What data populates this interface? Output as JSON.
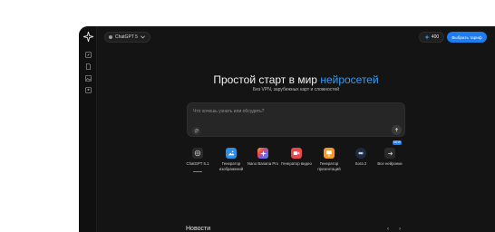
{
  "header": {
    "model_label": "ChatGPT 5",
    "credits": "400",
    "plan_button": "Выбрать тариф"
  },
  "hero": {
    "title_plain": "Простой старт в мир ",
    "title_accent": "нейросетей",
    "subtitle": "Без VPN, зарубежных карт и сложностей"
  },
  "prompt": {
    "placeholder": "Что хочешь узнать или обсудить?"
  },
  "tools": [
    {
      "label": "ChatGPT 5.1",
      "icon": "openai-icon",
      "color": "#2a2a2a",
      "active": true
    },
    {
      "label": "Генератор изображений",
      "icon": "image-generator-icon",
      "color": "#2e8fe0"
    },
    {
      "label": "Nano Banana Pro",
      "icon": "nano-banana-icon",
      "color": "#7b5cf0"
    },
    {
      "label": "Генератор видео",
      "icon": "video-generator-icon",
      "color": "#e8474c"
    },
    {
      "label": "Генератор презентаций",
      "icon": "presentation-generator-icon",
      "color": "#f59a23"
    },
    {
      "label": "Sora 2",
      "icon": "sora-icon",
      "color": "#1f2a44"
    },
    {
      "label": "Все нейронки",
      "icon": "arrow-right-icon",
      "color": "#2a2a2a",
      "badge": "NEW"
    }
  ],
  "news": {
    "title": "Новости"
  },
  "colors": {
    "accent": "#2f9cf3",
    "background": "#141414",
    "primary_button": "#1c7cf0"
  }
}
